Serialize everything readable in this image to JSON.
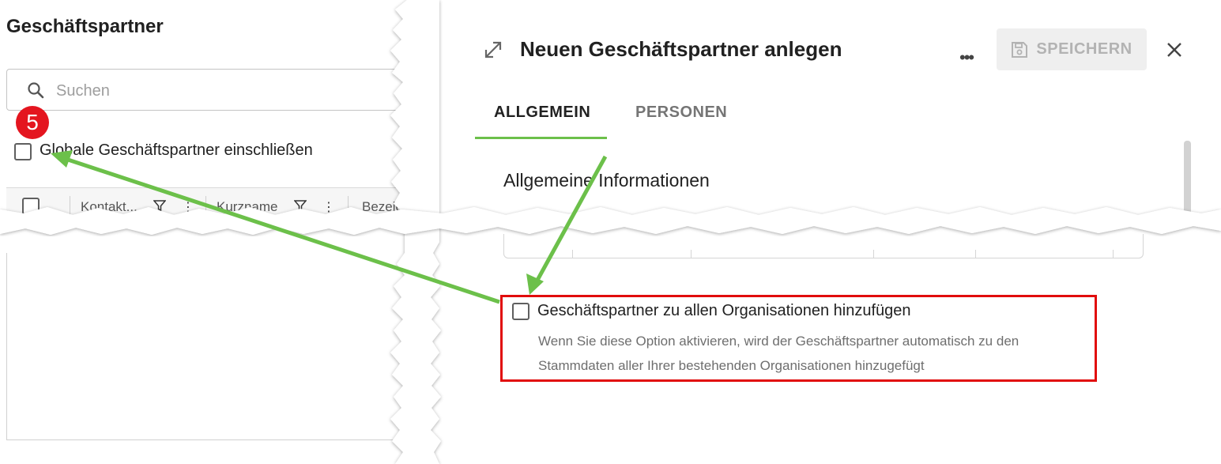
{
  "left": {
    "title": "Geschäftspartner",
    "search_placeholder": "Suchen",
    "badge": "5",
    "global_checkbox_label": "Globale Geschäftspartner einschließen",
    "columns": [
      "Kontakt...",
      "Kurzname",
      "Bezeic"
    ]
  },
  "dialog": {
    "title": "Neuen Geschäftspartner anlegen",
    "save_label": "SPEICHERN",
    "tabs": [
      {
        "label": "ALLGEMEIN",
        "active": true
      },
      {
        "label": "PERSONEN",
        "active": false
      }
    ],
    "section_title": "Allgemeine Informationen",
    "org_checkbox_label": "Geschäftspartner zu allen Organisationen hinzufügen",
    "org_description_line1": "Wenn Sie diese Option aktivieren, wird der Geschäftspartner automatisch zu den",
    "org_description_line2": "Stammdaten aller Ihrer bestehenden Organisationen hinzugefügt"
  },
  "colors": {
    "accent_green": "#6cc04a",
    "highlight_red": "#e10c0c",
    "badge_red": "#e4151f"
  },
  "icons": [
    "search-icon",
    "filter-icon",
    "kebab-icon",
    "expand-icon",
    "more-icon",
    "save-icon",
    "close-icon"
  ]
}
